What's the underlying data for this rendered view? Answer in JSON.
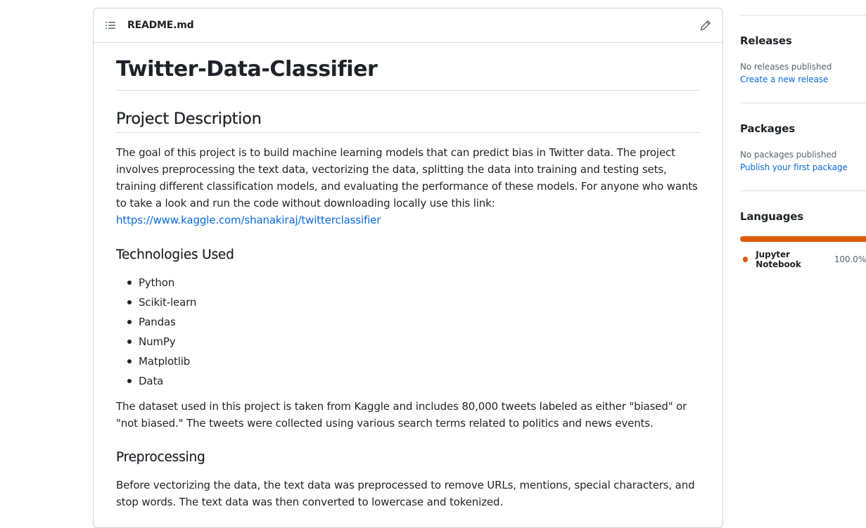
{
  "readme": {
    "filename": "README.md",
    "toc_icon": "list-unordered-icon",
    "edit_icon": "pencil-icon",
    "title": "Twitter-Data-Classifier",
    "sections": {
      "project_description": {
        "heading": "Project Description",
        "paragraph": "The goal of this project is to build machine learning models that can predict bias in Twitter data. The project involves preprocessing the text data, vectorizing the data, splitting the data into training and testing sets, training different classification models, and evaluating the performance of these models. For anyone who wants to take a look and run the code without downloading locally use this link:",
        "link_text": "https://www.kaggle.com/shanakiraj/twitterclassifier"
      },
      "technologies": {
        "heading": "Technologies Used",
        "items": [
          "Python",
          "Scikit-learn",
          "Pandas",
          "NumPy",
          "Matplotlib",
          "Data"
        ],
        "paragraph": "The dataset used in this project is taken from Kaggle and includes 80,000 tweets labeled as either \"biased\" or \"not biased.\" The tweets were collected using various search terms related to politics and news events."
      },
      "preprocessing": {
        "heading": "Preprocessing",
        "paragraph": "Before vectorizing the data, the text data was preprocessed to remove URLs, mentions, special characters, and stop words. The text data was then converted to lowercase and tokenized."
      }
    }
  },
  "sidebar": {
    "releases": {
      "title": "Releases",
      "status": "No releases published",
      "link": "Create a new release"
    },
    "packages": {
      "title": "Packages",
      "status": "No packages published",
      "link": "Publish your first package"
    },
    "languages": {
      "title": "Languages",
      "items": [
        {
          "name": "Jupyter Notebook",
          "percent": "100.0%",
          "percent_value": 100,
          "color": "#DA5B0B"
        }
      ]
    }
  },
  "colors": {
    "link": "#0969da",
    "border": "#d0d7de",
    "text": "#1f2328",
    "muted": "#59636e"
  }
}
